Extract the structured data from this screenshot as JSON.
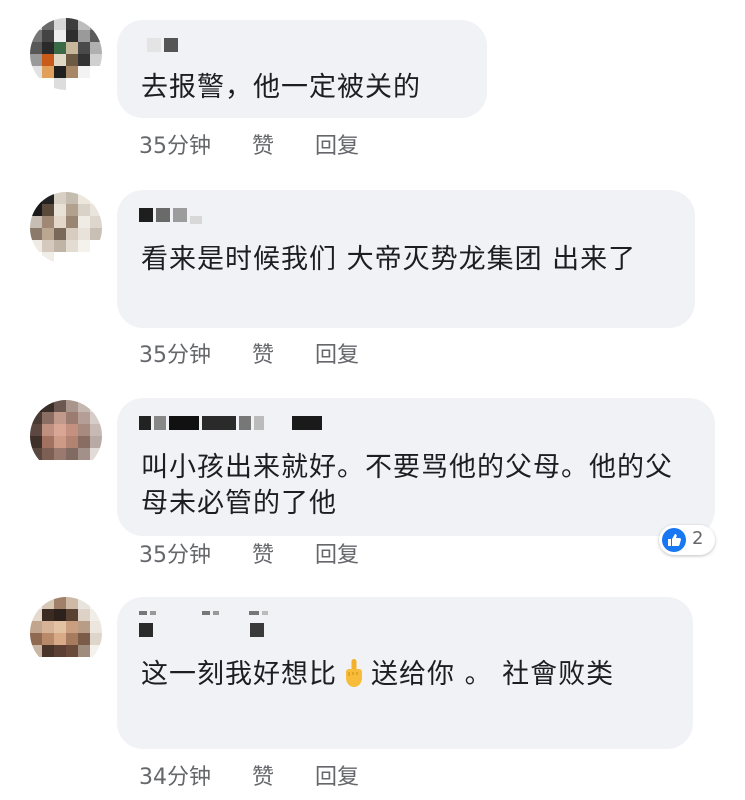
{
  "comments": [
    {
      "text": "去报警，他一定被关的",
      "time": "35分钟",
      "like": "赞",
      "reply": "回复"
    },
    {
      "text": "看来是时候我们 大帝灭势龙集团 出来了",
      "time": "35分钟",
      "like": "赞",
      "reply": "回复"
    },
    {
      "text": "叫小孩出来就好。不要骂他的父母。他的父母未必管的了他",
      "time": "35分钟",
      "like": "赞",
      "reply": "回复",
      "reaction_count": "2"
    },
    {
      "text_before_emoji": "这一刻我好想比",
      "text_after_emoji": "送给你 。 社會败类",
      "emoji_icon": "middle-finger-emoji",
      "time": "34分钟",
      "like": "赞",
      "reply": "回复"
    }
  ],
  "colors": {
    "bubble": "#f0f2f5",
    "text": "#1c1e21",
    "meta": "#65676b",
    "like_blue": "#1877f2"
  }
}
